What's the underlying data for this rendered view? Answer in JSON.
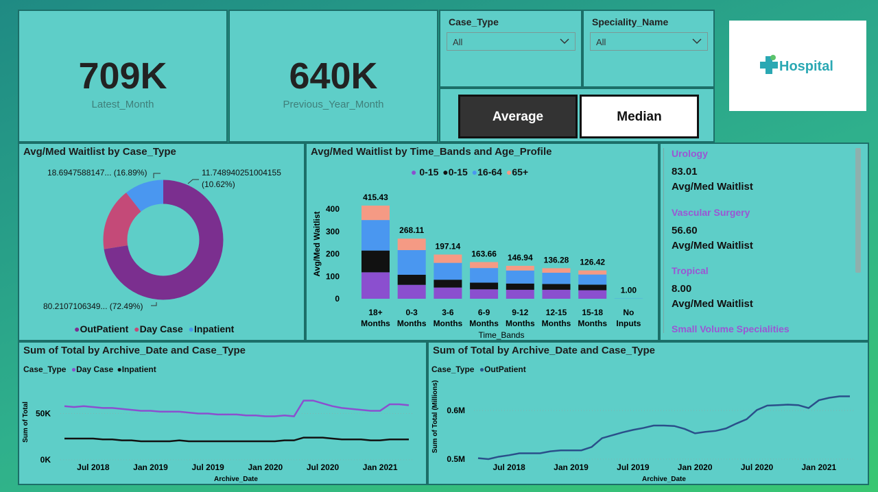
{
  "kpis": {
    "latest": {
      "value": "709K",
      "label": "Latest_Month"
    },
    "previous": {
      "value": "640K",
      "label": "Previous_Year_Month"
    }
  },
  "slicers": {
    "case_type": {
      "title": "Case_Type",
      "value": "All"
    },
    "speciality": {
      "title": "Speciality_Name",
      "value": "All"
    }
  },
  "toggles": {
    "average": "Average",
    "median": "Median"
  },
  "logo": {
    "text": "Hospital"
  },
  "donut": {
    "title": "Avg/Med Waitlist by Case_Type",
    "label_top_left": "18.6947588147... (16.89%)",
    "label_top_right_1": "11.748940251004155",
    "label_top_right_2": "(10.62%)",
    "label_bottom": "80.2107106349... (72.49%)",
    "legend": [
      "OutPatient",
      "Day Case",
      "Inpatient"
    ]
  },
  "bars": {
    "title": "Avg/Med Waitlist by Time_Bands and Age_Profile",
    "legend": [
      "0-15",
      "0-15",
      "16-64",
      "65+"
    ],
    "ylabel": "Avg/Med Waitlist",
    "xlabel": "Time_Bands",
    "yticks": [
      "400",
      "300",
      "200",
      "100",
      "0"
    ],
    "cat_line1": [
      "18+",
      "0-3",
      "3-6",
      "6-9",
      "9-12",
      "12-15",
      "15-18",
      "No"
    ],
    "cat_line2": [
      "Months",
      "Months",
      "Months",
      "Months",
      "Months",
      "Months",
      "Months",
      "Inputs"
    ],
    "totals": [
      "415.43",
      "268.11",
      "197.14",
      "163.66",
      "146.94",
      "136.28",
      "126.42",
      "1.00"
    ]
  },
  "cards": [
    {
      "category": "Urology",
      "value": "83.01",
      "label": "Avg/Med Waitlist"
    },
    {
      "category": "Vascular Surgery",
      "value": "56.60",
      "label": "Avg/Med Waitlist"
    },
    {
      "category": "Tropical",
      "value": "8.00",
      "label": "Avg/Med Waitlist"
    },
    {
      "category": "Small Volume Specialities"
    }
  ],
  "line_left": {
    "title": "Sum of Total by Archive_Date and Case_Type",
    "legend_title": "Case_Type",
    "legend": [
      "Day Case",
      "Inpatient"
    ],
    "ylabel": "Sum of Total",
    "xlabel": "Archive_Date",
    "yticks": [
      "50K",
      "0K"
    ],
    "xticks": [
      "Jul 2018",
      "Jan 2019",
      "Jul 2019",
      "Jan 2020",
      "Jul 2020",
      "Jan 2021"
    ]
  },
  "line_right": {
    "title": "Sum of Total by Archive_Date and Case_Type",
    "legend_title": "Case_Type",
    "legend": [
      "OutPatient"
    ],
    "ylabel": "Sum of Total (Millions)",
    "xlabel": "Archive_Date",
    "yticks": [
      "0.6M",
      "0.5M"
    ],
    "xticks": [
      "Jul 2018",
      "Jan 2019",
      "Jul 2019",
      "Jan 2020",
      "Jul 2020",
      "Jan 2021"
    ]
  },
  "colors": {
    "outpatient": "#7b2f8f",
    "daycase": "#c44a78",
    "inpatient": "#4a97f0",
    "purple": "#8b4fcf",
    "black": "#111111",
    "blue": "#4a97f0",
    "salmon": "#f59a84",
    "navy": "#2a4f8a"
  },
  "chart_data": [
    {
      "type": "pie",
      "title": "Avg/Med Waitlist by Case_Type",
      "categories": [
        "OutPatient",
        "Day Case",
        "Inpatient"
      ],
      "values": [
        80.2107106349,
        18.6947588147,
        11.748940251004155
      ],
      "percentages": [
        72.49,
        16.89,
        10.62
      ]
    },
    {
      "type": "bar",
      "title": "Avg/Med Waitlist by Time_Bands and Age_Profile",
      "categories": [
        "18+ Months",
        "0-3 Months",
        "3-6 Months",
        "6-9 Months",
        "9-12 Months",
        "12-15 Months",
        "15-18 Months",
        "No Inputs"
      ],
      "series": [
        {
          "name": "0-15",
          "values": [
            118,
            62,
            50,
            42,
            40,
            40,
            38,
            0
          ]
        },
        {
          "name": "0-15",
          "values": [
            97,
            45,
            35,
            30,
            28,
            26,
            25,
            0
          ]
        },
        {
          "name": "16-64",
          "values": [
            136,
            110,
            75,
            65,
            58,
            50,
            45,
            1.0
          ]
        },
        {
          "name": "65+",
          "values": [
            64.43,
            51.11,
            37.14,
            26.66,
            20.94,
            20.28,
            18.42,
            0
          ]
        }
      ],
      "totals": [
        415.43,
        268.11,
        197.14,
        163.66,
        146.94,
        136.28,
        126.42,
        1.0
      ],
      "ylim": [
        0,
        440
      ]
    },
    {
      "type": "line",
      "title": "Sum of Total by Archive_Date and Case_Type",
      "x": [
        "2018-04",
        "2018-05",
        "2018-06",
        "2018-07",
        "2018-08",
        "2018-09",
        "2018-10",
        "2018-11",
        "2018-12",
        "2019-01",
        "2019-02",
        "2019-03",
        "2019-04",
        "2019-05",
        "2019-06",
        "2019-07",
        "2019-08",
        "2019-09",
        "2019-10",
        "2019-11",
        "2019-12",
        "2020-01",
        "2020-02",
        "2020-03",
        "2020-04",
        "2020-05",
        "2020-06",
        "2020-07",
        "2020-08",
        "2020-09",
        "2020-10",
        "2020-11",
        "2020-12",
        "2021-01",
        "2021-02",
        "2021-03",
        "2021-04"
      ],
      "series": [
        {
          "name": "Day Case",
          "values": [
            58,
            57,
            58,
            57,
            56,
            56,
            55,
            54,
            53,
            53,
            52,
            52,
            52,
            51,
            50,
            50,
            49,
            49,
            49,
            48,
            48,
            47,
            47,
            48,
            47,
            64,
            64,
            61,
            58,
            56,
            55,
            54,
            53,
            53,
            60,
            60,
            59
          ]
        },
        {
          "name": "Inpatient",
          "values": [
            23,
            23,
            23,
            23,
            22,
            22,
            21,
            21,
            20,
            20,
            20,
            20,
            21,
            20,
            20,
            20,
            20,
            20,
            20,
            20,
            20,
            20,
            20,
            21,
            21,
            24,
            24,
            24,
            23,
            22,
            22,
            22,
            21,
            21,
            22,
            22,
            22
          ]
        }
      ],
      "yticks": [
        "0K",
        "50K"
      ]
    },
    {
      "type": "line",
      "title": "Sum of Total by Archive_Date and Case_Type",
      "x": [
        "2018-04",
        "2018-05",
        "2018-06",
        "2018-07",
        "2018-08",
        "2018-09",
        "2018-10",
        "2018-11",
        "2018-12",
        "2019-01",
        "2019-02",
        "2019-03",
        "2019-04",
        "2019-05",
        "2019-06",
        "2019-07",
        "2019-08",
        "2019-09",
        "2019-10",
        "2019-11",
        "2019-12",
        "2020-01",
        "2020-02",
        "2020-03",
        "2020-04",
        "2020-05",
        "2020-06",
        "2020-07",
        "2020-08",
        "2020-09",
        "2020-10",
        "2020-11",
        "2020-12",
        "2021-01",
        "2021-02",
        "2021-03",
        "2021-04"
      ],
      "series": [
        {
          "name": "OutPatient",
          "values": [
            0.502,
            0.5,
            0.505,
            0.508,
            0.512,
            0.512,
            0.512,
            0.516,
            0.518,
            0.518,
            0.518,
            0.525,
            0.543,
            0.549,
            0.555,
            0.56,
            0.564,
            0.569,
            0.569,
            0.568,
            0.562,
            0.553,
            0.556,
            0.558,
            0.563,
            0.573,
            0.582,
            0.601,
            0.61,
            0.611,
            0.612,
            0.611,
            0.605,
            0.621,
            0.626,
            0.629,
            0.629
          ]
        }
      ],
      "yticks": [
        "0.5M",
        "0.6M"
      ]
    }
  ]
}
